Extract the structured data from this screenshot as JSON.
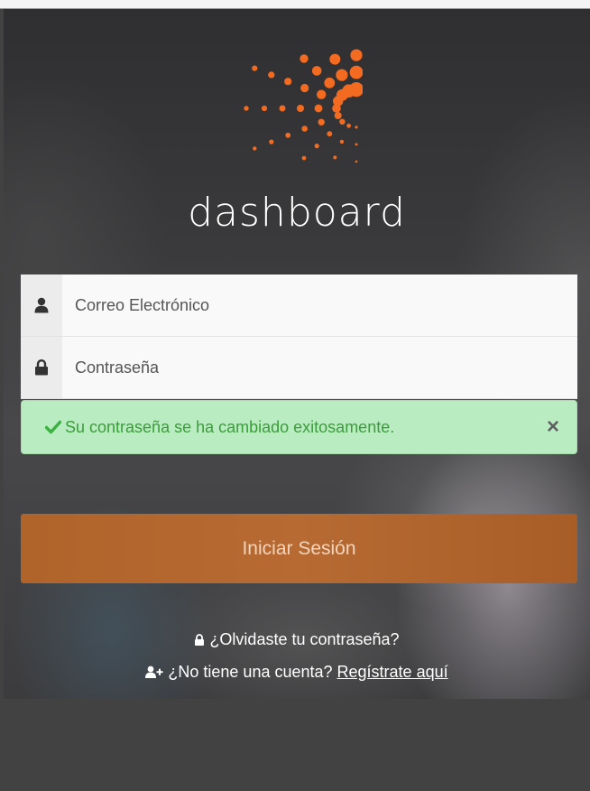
{
  "brand": {
    "name": "dashboard",
    "accent_color": "#f26b21"
  },
  "login_form": {
    "email_placeholder": "Correo Electrónico",
    "email_icon": "user-icon",
    "password_placeholder": "Contraseña",
    "password_icon": "lock-icon"
  },
  "alert": {
    "message": "Su contraseña se ha cambiado exitosamente.",
    "icon": "check-icon",
    "close_label": "×",
    "color": "#b9ecc0"
  },
  "submit": {
    "label": "Iniciar Sesión",
    "color": "#b0642a"
  },
  "links": {
    "forgot_password": "¿Olvidaste tu contraseña?",
    "no_account": "¿No tiene una cuenta?",
    "register": "Regístrate aquí"
  }
}
